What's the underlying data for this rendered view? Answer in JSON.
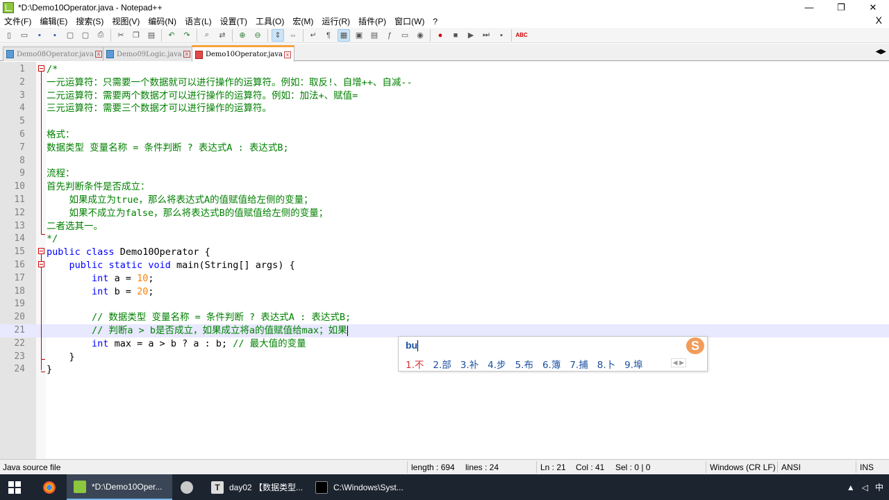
{
  "window": {
    "title": "*D:\\Demo10Operator.java - Notepad++",
    "controls": {
      "minimize": "—",
      "maximize": "❐",
      "close": "✕"
    }
  },
  "menu": {
    "items": [
      "文件(F)",
      "编辑(E)",
      "搜索(S)",
      "视图(V)",
      "编码(N)",
      "语言(L)",
      "设置(T)",
      "工具(O)",
      "宏(M)",
      "运行(R)",
      "插件(P)",
      "窗口(W)",
      "?"
    ],
    "close": "X"
  },
  "toolbar": {
    "icons": [
      "new-file-icon",
      "open-file-icon",
      "save-icon",
      "save-all-icon",
      "close-icon",
      "close-all-icon",
      "print-icon",
      "cut-icon",
      "copy-icon",
      "paste-icon",
      "undo-icon",
      "redo-icon",
      "find-icon",
      "replace-icon",
      "zoom-in-icon",
      "zoom-out-icon",
      "sync-vertical-icon",
      "sync-horizontal-icon",
      "word-wrap-icon",
      "show-all-chars-icon",
      "indent-guide-icon",
      "user-lang-icon",
      "doc-map-icon",
      "function-list-icon",
      "folder-workspace-icon",
      "monitoring-icon",
      "macro-record-icon",
      "macro-stop-icon",
      "macro-play-icon",
      "macro-run-multiple-icon",
      "macro-save-icon",
      "spell-check-icon"
    ],
    "spell_label": "ABC"
  },
  "tabs": [
    {
      "label": "Demo08Operator.java",
      "active": false
    },
    {
      "label": "Demo09Logic.java",
      "active": false
    },
    {
      "label": "Demo10Operator.java",
      "active": true
    }
  ],
  "tab_close": "x",
  "tab_arrows": "◀▶",
  "editor": {
    "line_numbers": [
      "1",
      "2",
      "3",
      "4",
      "5",
      "6",
      "7",
      "8",
      "9",
      "10",
      "11",
      "12",
      "13",
      "14",
      "15",
      "16",
      "17",
      "18",
      "19",
      "20",
      "21",
      "22",
      "23",
      "24"
    ],
    "lines": {
      "l1": "/*",
      "l2": "一元运算符：只需要一个数据就可以进行操作的运算符。例如：取反!、自增++、自减--",
      "l3": "二元运算符：需要两个数据才可以进行操作的运算符。例如：加法+、赋值=",
      "l4": "三元运算符：需要三个数据才可以进行操作的运算符。",
      "l6": "格式：",
      "l7": "数据类型 变量名称 = 条件判断 ? 表达式A : 表达式B;",
      "l9": "流程：",
      "l10": "首先判断条件是否成立：",
      "l11": "    如果成立为true，那么将表达式A的值赋值给左侧的变量；",
      "l12": "    如果不成立为false，那么将表达式B的值赋值给左侧的变量；",
      "l13": "二者选其一。",
      "l14": "*/",
      "l15_kw1": "public",
      "l15_kw2": "class",
      "l15_rest": "Demo10Operator {",
      "l16_kw1": "public",
      "l16_kw2": "static",
      "l16_kw3": "void",
      "l16_rest": "main(String[] args) {",
      "l17_type": "int",
      "l17_id": "a =",
      "l17_num": "10",
      "l17_end": ";",
      "l18_type": "int",
      "l18_id": "b =",
      "l18_num": "20",
      "l18_end": ";",
      "l20": "// 数据类型 变量名称 = 条件判断 ? 表达式A : 表达式B;",
      "l21": "// 判断a > b是否成立，如果成立将a的值赋值给max；如果",
      "l22_type": "int",
      "l22_code": "max = a > b ? a : b;",
      "l22_cmt": "// 最大值的变量",
      "l23": "}",
      "l24": "}"
    }
  },
  "ime": {
    "pinyin": "bu",
    "logo": "S",
    "candidates": [
      "1.不",
      "2.部",
      "3.补",
      "4.步",
      "5.布",
      "6.簿",
      "7.捕",
      "8.卜",
      "9.埠"
    ],
    "pager": "◀ ▶"
  },
  "status": {
    "filetype": "Java source file",
    "length": "length : 694",
    "lines": "lines : 24",
    "ln": "Ln : 21",
    "col": "Col : 41",
    "sel": "Sel : 0 | 0",
    "eol": "Windows (CR LF)",
    "encoding": "ANSI",
    "mode": "INS"
  },
  "taskbar": {
    "items": [
      {
        "label": "",
        "icon": "chrome-icon"
      },
      {
        "label": "*D:\\Demo10Oper...",
        "icon": "notepadpp-icon"
      },
      {
        "label": "",
        "icon": "paint-icon"
      },
      {
        "label": "day02 【数据类型...",
        "icon": "typora-icon"
      },
      {
        "label": "C:\\Windows\\Syst...",
        "icon": "cmd-icon"
      }
    ],
    "tray": {
      "ime": "中"
    }
  }
}
